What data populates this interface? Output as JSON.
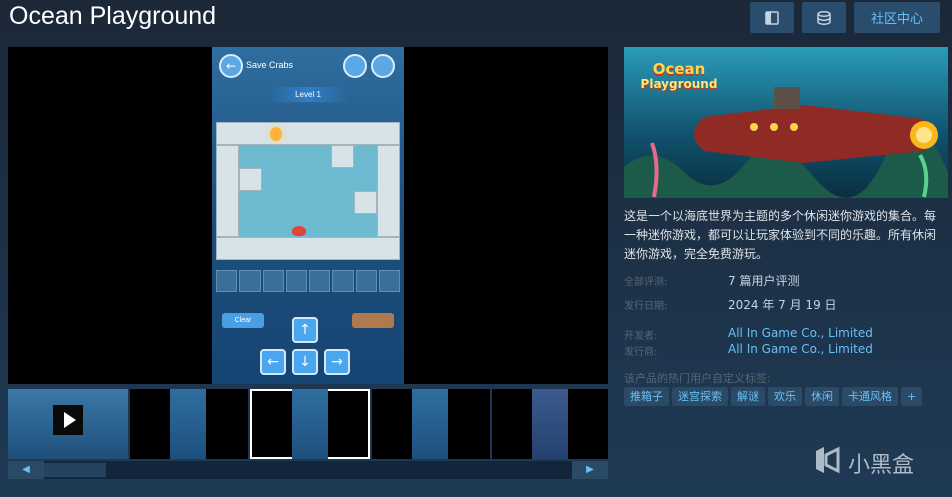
{
  "header": {
    "title": "Ocean Playground",
    "buttons": [
      {
        "icon": "sidebar-icon",
        "label": ""
      },
      {
        "icon": "database-icon",
        "label": ""
      },
      {
        "icon": "",
        "label": "社区中心"
      }
    ]
  },
  "media": {
    "game_screen": {
      "header_label": "Save Crabs",
      "level_label": "Level 1",
      "clear_label": "Clear"
    },
    "thumbnails": [
      {
        "kind": "video",
        "selected": false
      },
      {
        "kind": "image",
        "selected": false
      },
      {
        "kind": "image",
        "selected": true
      },
      {
        "kind": "image",
        "selected": false
      },
      {
        "kind": "image",
        "selected": false
      }
    ]
  },
  "capsule": {
    "logo_line1": "Ocean",
    "logo_line2": "Playground"
  },
  "description": "这是一个以海底世界为主题的多个休闲迷你游戏的集合。每一种迷你游戏，都可以让玩家体验到不同的乐趣。所有休闲迷你游戏，完全免费游玩。",
  "info": {
    "reviews_label": "全部评测:",
    "reviews_value": "7 篇用户评测",
    "release_label": "发行日期:",
    "release_value": "2024 年 7 月 19 日",
    "developer_label": "开发者:",
    "developer_value": "All In Game Co., Limited",
    "publisher_label": "发行商:",
    "publisher_value": "All In Game Co., Limited"
  },
  "tags": {
    "label": "该产品的热门用户自定义标签:",
    "items": [
      "推箱子",
      "迷宫探索",
      "解谜",
      "欢乐",
      "休闲",
      "卡通风格",
      "+"
    ]
  },
  "watermark": {
    "text": "小黑盒"
  },
  "colors": {
    "background": "#1b2838",
    "link": "#66c0f4",
    "button": "#2a4d6e"
  }
}
